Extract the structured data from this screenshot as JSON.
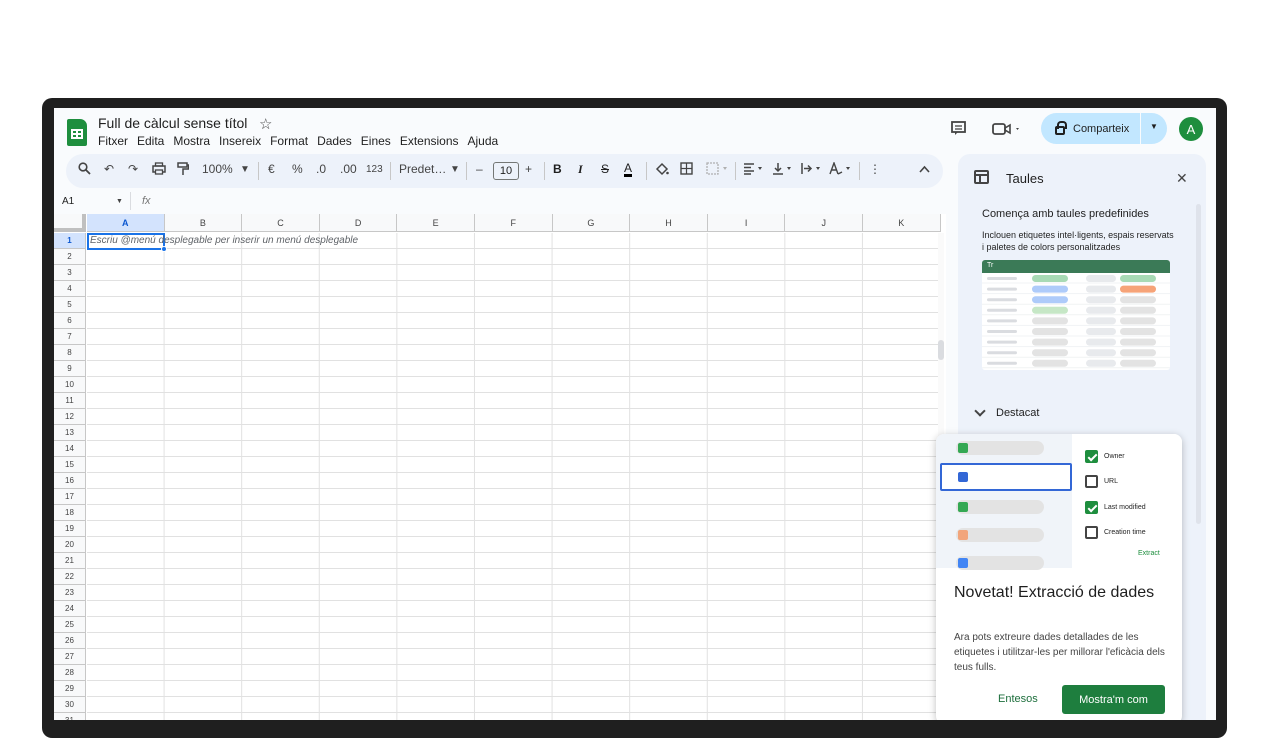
{
  "header": {
    "doc_title": "Full de càlcul sense títol",
    "menu": [
      "Fitxer",
      "Edita",
      "Mostra",
      "Insereix",
      "Format",
      "Dades",
      "Eines",
      "Extensions",
      "Ajuda"
    ],
    "share_label": "Comparteix",
    "avatar_letter": "A"
  },
  "toolbar": {
    "zoom": "100%",
    "currency": "€",
    "percent": "%",
    "dec_less": ".0",
    "dec_more": ".00",
    "number_fmt": "123",
    "font": "Predet…",
    "font_size": "10",
    "bold": "B",
    "italic": "I",
    "strike": "S",
    "text_color": "A"
  },
  "formula_bar": {
    "name_box": "A1",
    "fx": "fx"
  },
  "grid": {
    "columns": [
      "A",
      "B",
      "C",
      "D",
      "E",
      "F",
      "G",
      "H",
      "I",
      "J",
      "K"
    ],
    "rows": [
      "1",
      "2",
      "3",
      "4",
      "5",
      "6",
      "7",
      "8",
      "9",
      "10",
      "11",
      "12",
      "13",
      "14",
      "15",
      "16",
      "17",
      "18",
      "19",
      "20",
      "21",
      "22",
      "23",
      "24",
      "25",
      "26",
      "27",
      "28",
      "29",
      "30",
      "31"
    ],
    "selected_cell": "A1",
    "cell_hint": "Escriu @menú desplegable per inserir un menú desplegable"
  },
  "side_panel": {
    "title": "Taules",
    "heading": "Comença amb taules predefinides",
    "description": "Inclouen etiquetes intel·ligents, espais reservats i paletes de colors personalitzades",
    "preview_headers": [
      "Tr",
      "",
      "",
      ""
    ],
    "featured_label": "Destacat"
  },
  "promo": {
    "checkboxes": [
      {
        "label": "Owner",
        "checked": true
      },
      {
        "label": "URL",
        "checked": false
      },
      {
        "label": "Last modified",
        "checked": true
      },
      {
        "label": "Creation time",
        "checked": false
      }
    ],
    "extract_label": "Extract",
    "title": "Novetat! Extracció de dades",
    "description": "Ara pots extreure dades detallades de les etiquetes i utilitzar-les per millorar l'eficàcia dels teus fulls.",
    "dismiss_label": "Entesos",
    "primary_label": "Mostra'm com"
  },
  "colors": {
    "accent_blue": "#1a73e8",
    "sheets_green": "#1e8e3e",
    "share_bg": "#c2e7ff",
    "toolbar_bg": "#edf2fa"
  }
}
